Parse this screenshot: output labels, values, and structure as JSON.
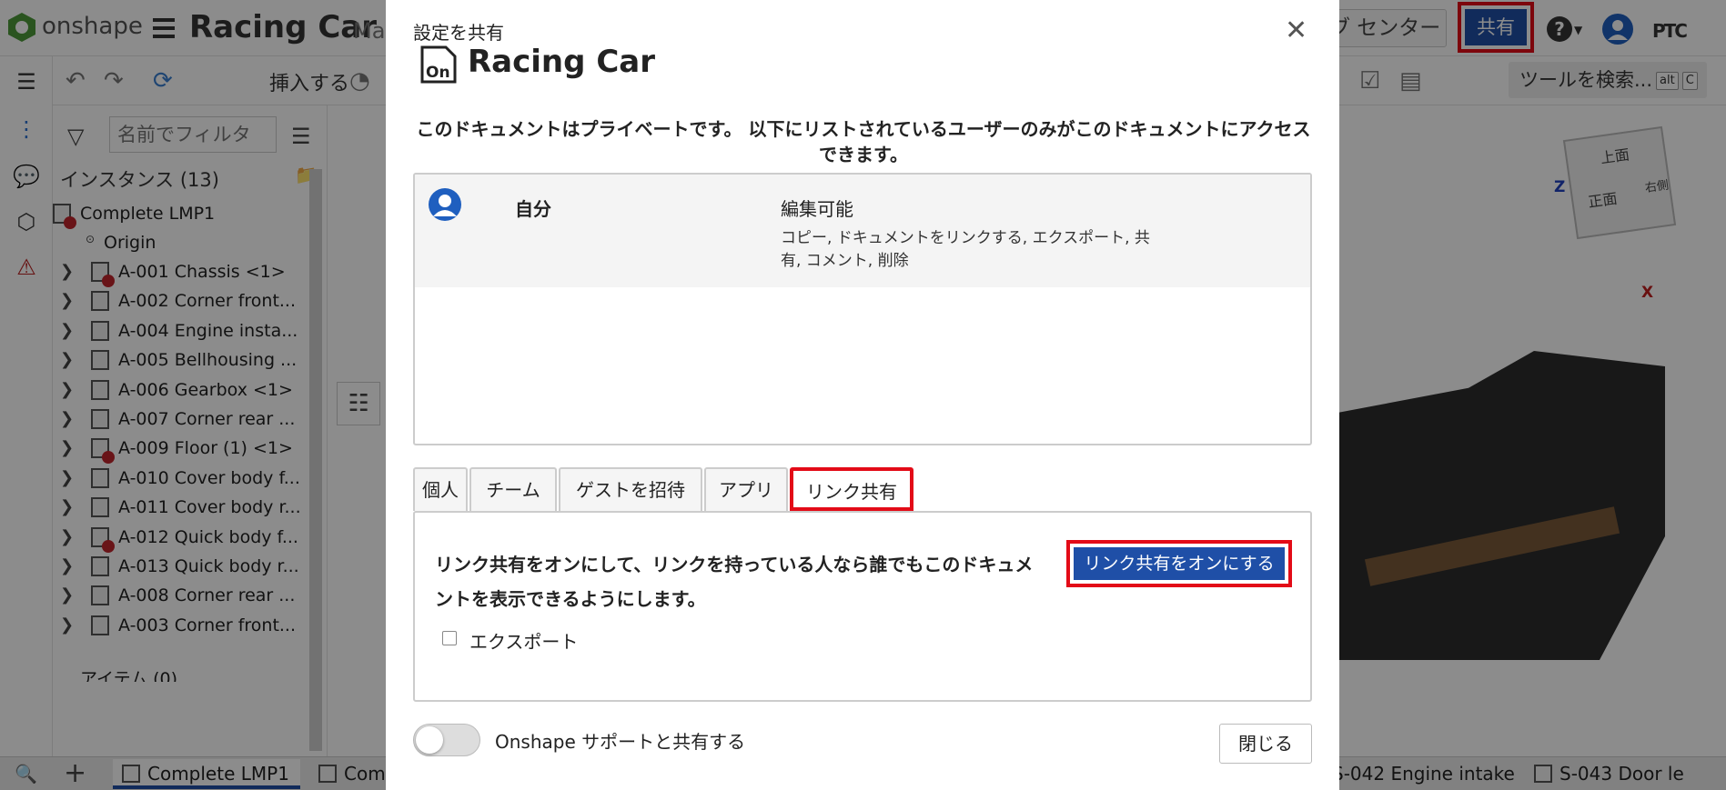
{
  "app": {
    "brand": "onshape",
    "document_title": "Racing Car",
    "document_sub": "Mai"
  },
  "topbar": {
    "learning_center": "ブ センター",
    "share_label": "共有",
    "help_icon": "?",
    "brand_logo_text": "PTC"
  },
  "toolbar": {
    "insert_label": "挿入する",
    "search_tools_label": "ツールを検索...",
    "search_tools_kbd": [
      "alt",
      "C"
    ]
  },
  "feature_panel": {
    "filter_placeholder": "名前でフィルタ",
    "instances_header": "インスタンス (13)",
    "root_item": "Complete LMP1",
    "origin": "Origin",
    "items": [
      "A-001 Chassis <1>",
      "A-002 Corner front...",
      "A-004 Engine insta...",
      "A-005 Bellhousing ...",
      "A-006 Gearbox <1>",
      "A-007 Corner rear ...",
      "A-009 Floor (1) <1>",
      "A-010 Cover body f...",
      "A-011 Cover body r...",
      "A-012 Quick body f...",
      "A-013 Quick body r...",
      "A-008 Corner rear ...",
      "A-003 Corner front..."
    ],
    "items_footer": "アイテム (0)"
  },
  "viewport": {
    "cube_top": "上面",
    "cube_front": "正面",
    "cube_right": "右側",
    "axis_z": "Z",
    "axis_x": "X"
  },
  "bottom_tabs": [
    {
      "label": "Complete LMP1",
      "active": true
    },
    {
      "label": "Com",
      "active": false
    },
    {
      "label": "S-042 Engine intake",
      "active": false
    },
    {
      "label": "S-043 Door le",
      "active": false
    }
  ],
  "modal": {
    "header_label": "設定を共有",
    "title": "Racing Car",
    "doc_icon_text": "On",
    "private_notice": "このドキュメントはプライベートです。 以下にリストされているユーザーのみがこのドキュメントにアクセスできます。",
    "permission": {
      "name": "自分",
      "level": "編集可能",
      "details": "コピー, ドキュメントをリンクする, エクスポート, 共有, コメント, 削除"
    },
    "tabs": [
      {
        "label": "個人",
        "active": false
      },
      {
        "label": "チーム",
        "active": false
      },
      {
        "label": "ゲストを招待",
        "active": false
      },
      {
        "label": "アプリ",
        "active": false
      },
      {
        "label": "リンク共有",
        "active": true
      }
    ],
    "link_share": {
      "description": "リンク共有をオンにして、リンクを持っている人なら誰でもこのドキュメントを表示できるようにします。",
      "button_label": "リンク共有をオンにする",
      "export_label": "エクスポート",
      "export_checked": false
    },
    "support_toggle": {
      "label": "Onshape サポートと共有する",
      "on": false
    },
    "close_label": "閉じる"
  },
  "colors": {
    "accent_blue": "#1f4fa7",
    "highlight_red": "#e30b17"
  }
}
